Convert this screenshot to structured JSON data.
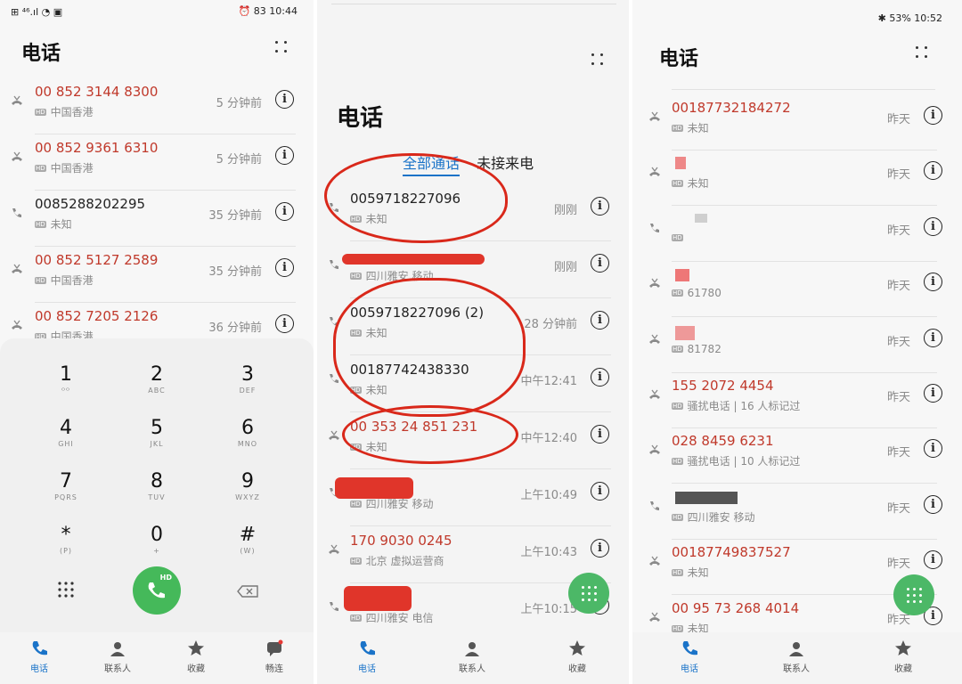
{
  "panel1": {
    "status_left": "⊞ ⁴⁶.ıl ◔ ▣",
    "status_right": "⏰ 83 10:44",
    "title": "电话",
    "calls": [
      {
        "number": "00 852 3144 8300",
        "location": "中国香港",
        "time": "5 分钟前",
        "missed": true
      },
      {
        "number": "00 852 9361 6310",
        "location": "中国香港",
        "time": "5 分钟前",
        "missed": true
      },
      {
        "number": "0085288202295",
        "location": "未知",
        "time": "35 分钟前",
        "missed": false
      },
      {
        "number": "00 852 5127 2589",
        "location": "中国香港",
        "time": "35 分钟前",
        "missed": true
      },
      {
        "number": "00 852 7205 2126",
        "location": "中国香港",
        "time": "36 分钟前",
        "missed": true
      }
    ],
    "keypad": [
      {
        "digit": "1",
        "letters": "ᴼᴼ"
      },
      {
        "digit": "2",
        "letters": "ABC"
      },
      {
        "digit": "3",
        "letters": "DEF"
      },
      {
        "digit": "4",
        "letters": "GHI"
      },
      {
        "digit": "5",
        "letters": "JKL"
      },
      {
        "digit": "6",
        "letters": "MNO"
      },
      {
        "digit": "7",
        "letters": "PQRS"
      },
      {
        "digit": "8",
        "letters": "TUV"
      },
      {
        "digit": "9",
        "letters": "WXYZ"
      },
      {
        "digit": "*",
        "letters": "(P)"
      },
      {
        "digit": "0",
        "letters": "+"
      },
      {
        "digit": "#",
        "letters": "(W)"
      }
    ],
    "call_label": "HD",
    "nav": [
      "电话",
      "联系人",
      "收藏",
      "畅连"
    ]
  },
  "panel2": {
    "title": "电话",
    "tab_all": "全部通话",
    "tab_missed": "未接来电",
    "calls": [
      {
        "number": "0059718227096",
        "location": "未知",
        "time": "刚刚",
        "missed": false
      },
      {
        "number": "",
        "location": "四川雅安 移动",
        "time": "刚刚",
        "missed": false
      },
      {
        "number": "0059718227096 (2)",
        "location": "未知",
        "time": "28 分钟前",
        "missed": false
      },
      {
        "number": "00187742438330",
        "location": "未知",
        "time": "中午12:41",
        "missed": false
      },
      {
        "number": "00 353 24 851 231",
        "location": "未知",
        "time": "中午12:40",
        "missed": true
      },
      {
        "number": "",
        "location": "四川雅安 移动",
        "time": "上午10:49",
        "missed": false
      },
      {
        "number": "170 9030 0245",
        "location": "北京 虚拟运营商",
        "time": "上午10:43",
        "missed": true
      },
      {
        "number": "",
        "location": "四川雅安 电信",
        "time": "上午10:15",
        "missed": false
      }
    ],
    "nav": [
      "电话",
      "联系人",
      "收藏"
    ]
  },
  "panel3": {
    "status_right": "✱ 53% 10:52",
    "title": "电话",
    "calls": [
      {
        "number": "00187732184272",
        "location": "未知",
        "time": "昨天",
        "missed": true
      },
      {
        "number": "",
        "location": "未知",
        "time": "昨天",
        "missed": true
      },
      {
        "number": "",
        "location": "",
        "time": "昨天",
        "missed": false
      },
      {
        "number": "",
        "location": "61780",
        "time": "昨天",
        "missed": true
      },
      {
        "number": "",
        "location": "81782",
        "time": "昨天",
        "missed": true
      },
      {
        "number": "155 2072 4454",
        "location": "骚扰电话 | 16 人标记过",
        "time": "昨天",
        "missed": true
      },
      {
        "number": "028 8459 6231",
        "location": "骚扰电话 | 10 人标记过",
        "time": "昨天",
        "missed": true
      },
      {
        "number": "",
        "location": "四川雅安 移动",
        "time": "昨天",
        "missed": false
      },
      {
        "number": "00187749837527",
        "location": "未知",
        "time": "昨天",
        "missed": true
      },
      {
        "number": "00 95 73 268 4014",
        "location": "未知",
        "time": "昨天",
        "missed": true
      }
    ],
    "nav": [
      "电话",
      "联系人",
      "收藏"
    ]
  },
  "icons": {
    "info": "i",
    "missed_call": "missed-call-icon",
    "incoming_call": "incoming-call-icon"
  }
}
